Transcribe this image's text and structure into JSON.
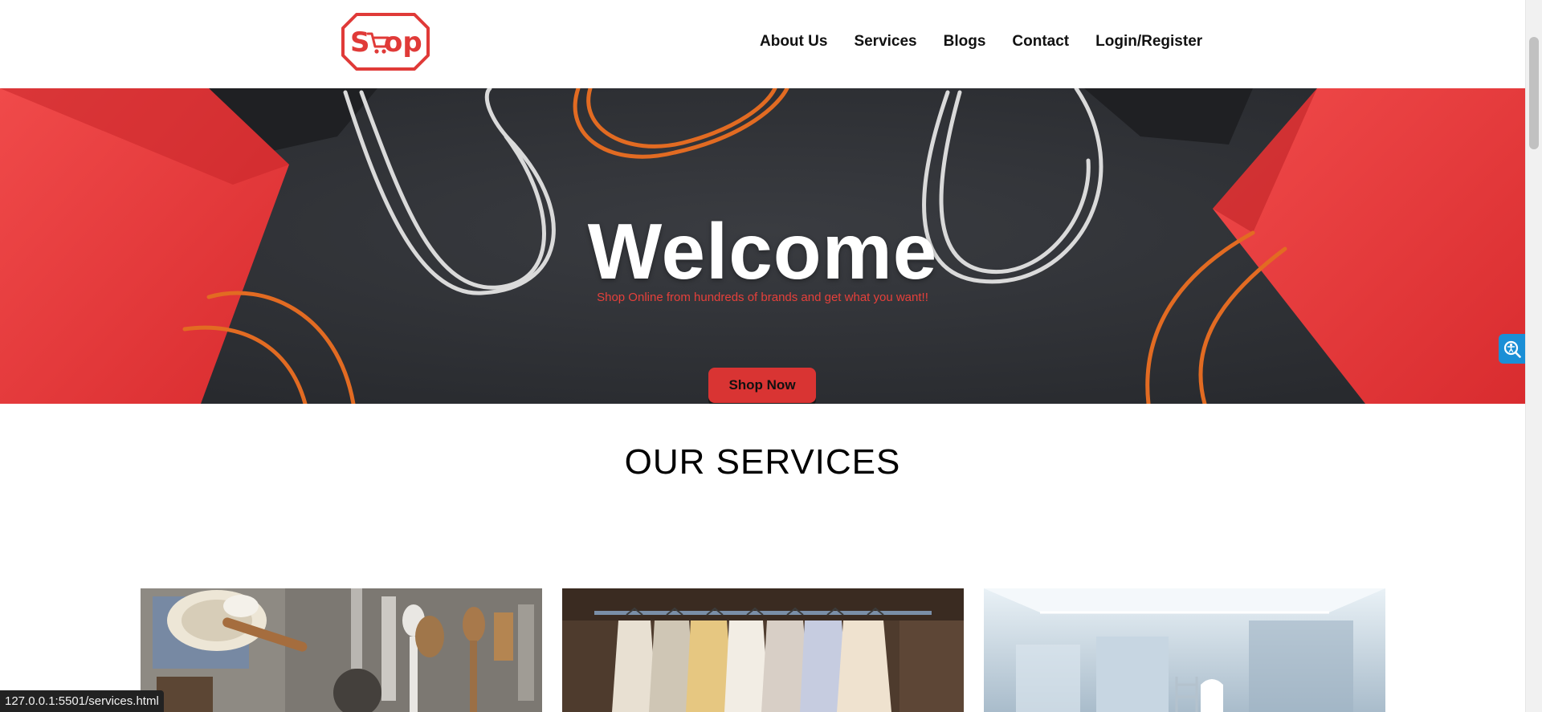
{
  "header": {
    "logo_text": "Shop",
    "nav": [
      "About Us",
      "Services",
      "Blogs",
      "Contact",
      "Login/Register"
    ],
    "brand_color": "#e03a38"
  },
  "hero": {
    "title": "Welcome",
    "subtitle": "Shop Online from hundreds of brands and get what you want!!",
    "button_label": "Shop Now",
    "background": "shopping-bags-photo"
  },
  "services": {
    "title": "OUR SERVICES",
    "cards": [
      {
        "image": "kitchen-utensils-photo"
      },
      {
        "image": "clothes-rack-photo"
      },
      {
        "image": "bathroom-photo"
      }
    ]
  },
  "accessibility_widget": {
    "icon": "accessibility-magnifier-icon",
    "color": "#1b8fd6"
  },
  "status_bar": {
    "url": "127.0.0.1:5501/services.html"
  }
}
